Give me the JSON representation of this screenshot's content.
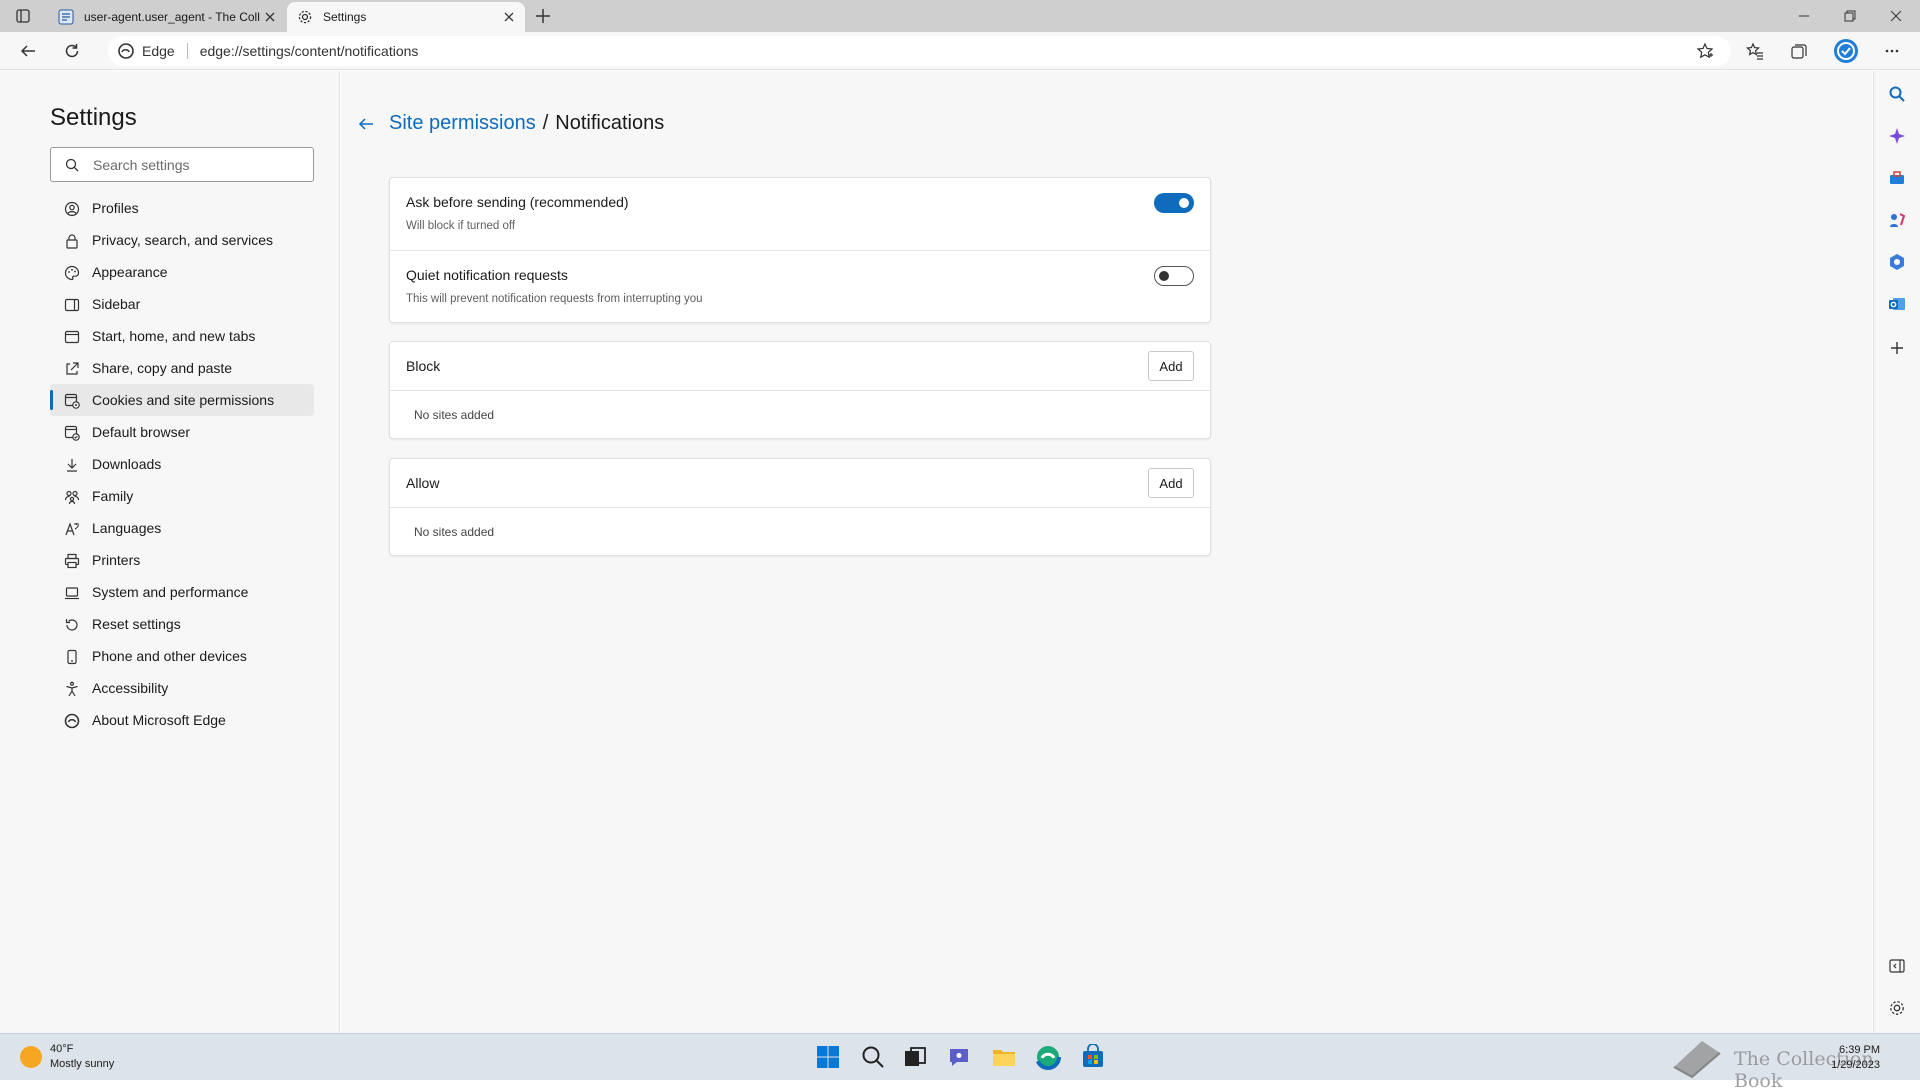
{
  "browser": {
    "tabs": [
      {
        "title": "user-agent.user_agent - The Coll",
        "active": false
      },
      {
        "title": "Settings",
        "active": true
      }
    ],
    "address": {
      "site_label": "Edge",
      "url": "edge://settings/content/notifications"
    }
  },
  "settings": {
    "title": "Settings",
    "search_placeholder": "Search settings",
    "nav": [
      {
        "label": "Profiles",
        "icon": "profile-icon"
      },
      {
        "label": "Privacy, search, and services",
        "icon": "lock-icon"
      },
      {
        "label": "Appearance",
        "icon": "appearance-icon"
      },
      {
        "label": "Sidebar",
        "icon": "sidebar-icon"
      },
      {
        "label": "Start, home, and new tabs",
        "icon": "home-icon"
      },
      {
        "label": "Share, copy and paste",
        "icon": "share-icon"
      },
      {
        "label": "Cookies and site permissions",
        "icon": "cookies-icon",
        "active": true
      },
      {
        "label": "Default browser",
        "icon": "browser-icon"
      },
      {
        "label": "Downloads",
        "icon": "download-icon"
      },
      {
        "label": "Family",
        "icon": "family-icon"
      },
      {
        "label": "Languages",
        "icon": "languages-icon"
      },
      {
        "label": "Printers",
        "icon": "printer-icon"
      },
      {
        "label": "System and performance",
        "icon": "system-icon"
      },
      {
        "label": "Reset settings",
        "icon": "reset-icon"
      },
      {
        "label": "Phone and other devices",
        "icon": "phone-icon"
      },
      {
        "label": "Accessibility",
        "icon": "accessibility-icon"
      },
      {
        "label": "About Microsoft Edge",
        "icon": "edge-icon"
      }
    ]
  },
  "page": {
    "breadcrumb_parent": "Site permissions",
    "breadcrumb_separator": "/",
    "breadcrumb_current": "Notifications",
    "toggles": [
      {
        "title": "Ask before sending (recommended)",
        "subtitle": "Will block if turned off",
        "on": true
      },
      {
        "title": "Quiet notification requests",
        "subtitle": "This will prevent notification requests from interrupting you",
        "on": false
      }
    ],
    "block": {
      "title": "Block",
      "add_label": "Add",
      "empty_text": "No sites added"
    },
    "allow": {
      "title": "Allow",
      "add_label": "Add",
      "empty_text": "No sites added"
    }
  },
  "taskbar": {
    "weather_temp": "40°F",
    "weather_desc": "Mostly sunny",
    "time": "6:39 PM",
    "date": "1/29/2023",
    "watermark_text": "The Collection Book"
  },
  "colors": {
    "accent": "#0f6cbd",
    "background": "#f7f7f7"
  }
}
